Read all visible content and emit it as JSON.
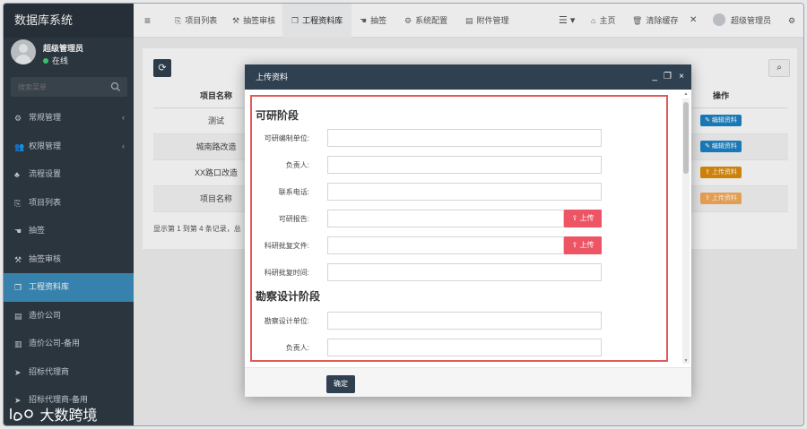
{
  "brand": "数据库系统",
  "user": {
    "name": "超级管理员",
    "status": "在线"
  },
  "search": {
    "placeholder": "搜索菜单"
  },
  "menu": [
    {
      "label": "常规管理",
      "icon": "cogs-icon",
      "has_chevron": true
    },
    {
      "label": "权限管理",
      "icon": "users-icon",
      "has_chevron": true
    },
    {
      "label": "流程设置",
      "icon": "sitemap-icon",
      "has_chevron": false
    },
    {
      "label": "项目列表",
      "icon": "copy-icon",
      "has_chevron": false
    },
    {
      "label": "抽签",
      "icon": "hand-icon",
      "has_chevron": false
    },
    {
      "label": "抽签审核",
      "icon": "gavel-icon",
      "has_chevron": false
    },
    {
      "label": "工程资料库",
      "icon": "files-icon",
      "has_chevron": false,
      "active": true
    },
    {
      "label": "造价公司",
      "icon": "list-icon",
      "has_chevron": false
    },
    {
      "label": "造价公司-备用",
      "icon": "building-icon",
      "has_chevron": false
    },
    {
      "label": "招标代理商",
      "icon": "send-icon",
      "has_chevron": false
    },
    {
      "label": "招标代理商-备用",
      "icon": "send-icon",
      "has_chevron": false
    }
  ],
  "topnav": {
    "menu_toggle": "≡",
    "tabs": [
      "项目列表",
      "抽签审核",
      "工程资料库",
      "抽签",
      "系统配置",
      "附件管理"
    ],
    "home": "主页",
    "clear_cache": "清除缓存",
    "admin": "超级管理员"
  },
  "table": {
    "headers": [
      "项目名称",
      "操作"
    ],
    "rows": [
      {
        "name": "测试",
        "action": "编辑资料",
        "action_color": "#1c84c6"
      },
      {
        "name": "城南路改造",
        "action": "编辑资料",
        "action_color": "#1c84c6"
      },
      {
        "name": "XX路口改造",
        "action": "上传资料",
        "action_color": "#e08e0b"
      },
      {
        "name": "项目名称",
        "action": "上传资料",
        "action_color": "#f8ac59"
      }
    ],
    "summary": "显示第 1 到第 4 条记录，总"
  },
  "modal": {
    "title": "上传资料",
    "section1": "可研阶段",
    "fields1": [
      {
        "label": "可研编制单位:",
        "upload": false
      },
      {
        "label": "负责人:",
        "upload": false
      },
      {
        "label": "联系电话:",
        "upload": false
      },
      {
        "label": "可研报告:",
        "upload": true
      },
      {
        "label": "科研批复文件:",
        "upload": true
      },
      {
        "label": "科研批复时间:",
        "upload": false
      }
    ],
    "section2": "勘察设计阶段",
    "fields2": [
      {
        "label": "勘察设计单位:",
        "upload": false
      },
      {
        "label": "负责人:",
        "upload": false
      }
    ],
    "upload_label": "上传",
    "confirm": "确定"
  },
  "watermark": "大数跨境"
}
